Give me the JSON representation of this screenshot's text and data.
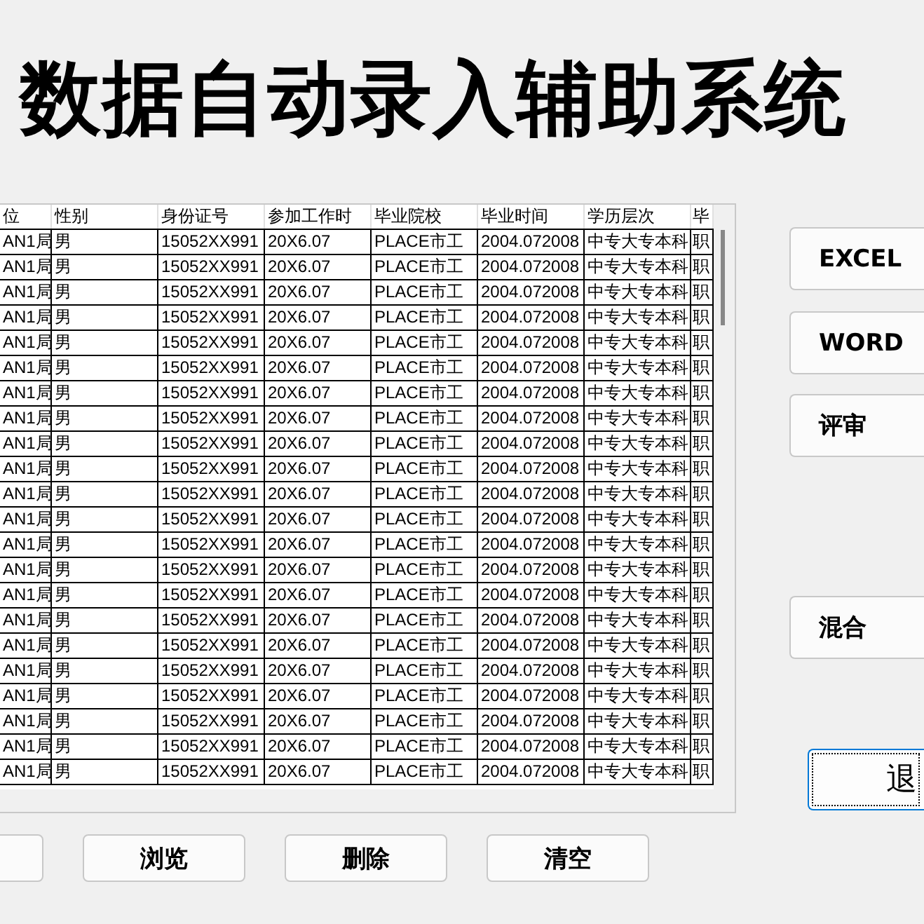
{
  "title": "数据自动录入辅助系统",
  "table": {
    "columns": [
      "位",
      "性别",
      "身份证号",
      "参加工作时",
      "毕业院校",
      "毕业时间",
      "学历层次",
      "毕"
    ],
    "rows": [
      [
        "AN1局",
        "男",
        "15052XX991",
        "20X6.07",
        "PLACE市工",
        "2004.072008",
        "中专大专本科",
        "职"
      ],
      [
        "AN1局",
        "男",
        "15052XX991",
        "20X6.07",
        "PLACE市工",
        "2004.072008",
        "中专大专本科",
        "职"
      ],
      [
        "AN1局",
        "男",
        "15052XX991",
        "20X6.07",
        "PLACE市工",
        "2004.072008",
        "中专大专本科",
        "职"
      ],
      [
        "AN1局",
        "男",
        "15052XX991",
        "20X6.07",
        "PLACE市工",
        "2004.072008",
        "中专大专本科",
        "职"
      ],
      [
        "AN1局",
        "男",
        "15052XX991",
        "20X6.07",
        "PLACE市工",
        "2004.072008",
        "中专大专本科",
        "职"
      ],
      [
        "AN1局",
        "男",
        "15052XX991",
        "20X6.07",
        "PLACE市工",
        "2004.072008",
        "中专大专本科",
        "职"
      ],
      [
        "AN1局",
        "男",
        "15052XX991",
        "20X6.07",
        "PLACE市工",
        "2004.072008",
        "中专大专本科",
        "职"
      ],
      [
        "AN1局",
        "男",
        "15052XX991",
        "20X6.07",
        "PLACE市工",
        "2004.072008",
        "中专大专本科",
        "职"
      ],
      [
        "AN1局",
        "男",
        "15052XX991",
        "20X6.07",
        "PLACE市工",
        "2004.072008",
        "中专大专本科",
        "职"
      ],
      [
        "AN1局",
        "男",
        "15052XX991",
        "20X6.07",
        "PLACE市工",
        "2004.072008",
        "中专大专本科",
        "职"
      ],
      [
        "AN1局",
        "男",
        "15052XX991",
        "20X6.07",
        "PLACE市工",
        "2004.072008",
        "中专大专本科",
        "职"
      ],
      [
        "AN1局",
        "男",
        "15052XX991",
        "20X6.07",
        "PLACE市工",
        "2004.072008",
        "中专大专本科",
        "职"
      ],
      [
        "AN1局",
        "男",
        "15052XX991",
        "20X6.07",
        "PLACE市工",
        "2004.072008",
        "中专大专本科",
        "职"
      ],
      [
        "AN1局",
        "男",
        "15052XX991",
        "20X6.07",
        "PLACE市工",
        "2004.072008",
        "中专大专本科",
        "职"
      ],
      [
        "AN1局",
        "男",
        "15052XX991",
        "20X6.07",
        "PLACE市工",
        "2004.072008",
        "中专大专本科",
        "职"
      ],
      [
        "AN1局",
        "男",
        "15052XX991",
        "20X6.07",
        "PLACE市工",
        "2004.072008",
        "中专大专本科",
        "职"
      ],
      [
        "AN1局",
        "男",
        "15052XX991",
        "20X6.07",
        "PLACE市工",
        "2004.072008",
        "中专大专本科",
        "职"
      ],
      [
        "AN1局",
        "男",
        "15052XX991",
        "20X6.07",
        "PLACE市工",
        "2004.072008",
        "中专大专本科",
        "职"
      ],
      [
        "AN1局",
        "男",
        "15052XX991",
        "20X6.07",
        "PLACE市工",
        "2004.072008",
        "中专大专本科",
        "职"
      ],
      [
        "AN1局",
        "男",
        "15052XX991",
        "20X6.07",
        "PLACE市工",
        "2004.072008",
        "中专大专本科",
        "职"
      ],
      [
        "AN1局",
        "男",
        "15052XX991",
        "20X6.07",
        "PLACE市工",
        "2004.072008",
        "中专大专本科",
        "职"
      ],
      [
        "AN1局",
        "男",
        "15052XX991",
        "20X6.07",
        "PLACE市工",
        "2004.072008",
        "中专大专本科",
        "职"
      ]
    ]
  },
  "side_buttons": [
    {
      "label": "EXCEL",
      "kind": "normal"
    },
    {
      "label": "WORD",
      "kind": "normal"
    },
    {
      "label": "评审",
      "kind": "normal"
    },
    {
      "label": "混合",
      "kind": "normal"
    },
    {
      "label": "退",
      "kind": "focused"
    }
  ],
  "bottom_buttons": [
    "浏览",
    "删除",
    "清空"
  ]
}
